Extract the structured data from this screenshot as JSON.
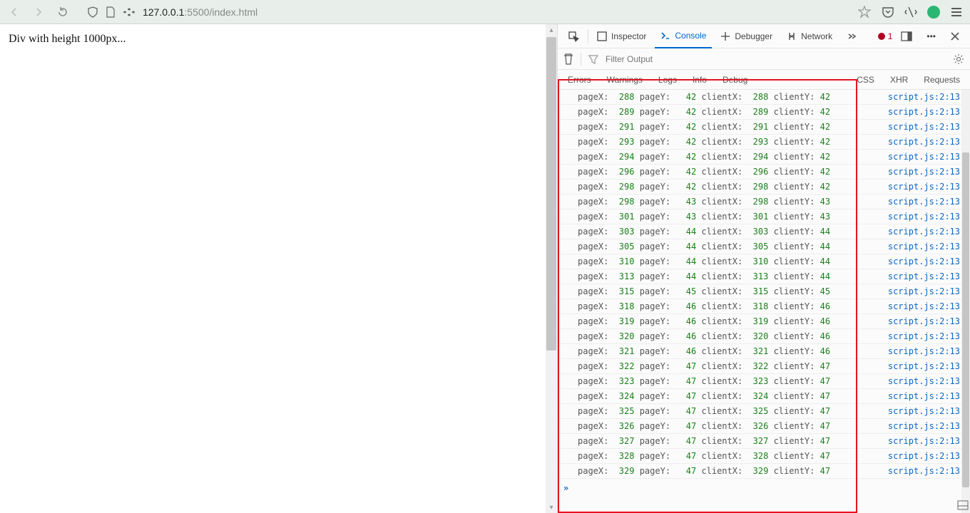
{
  "url": {
    "host": "127.0.0.1",
    "port": ":5500",
    "path": "/index.html"
  },
  "page": {
    "body_text": "Div with height 1000px..."
  },
  "devtools": {
    "tabs": {
      "inspector": "Inspector",
      "console": "Console",
      "debugger": "Debugger",
      "network": "Network"
    },
    "errors_badge": "1",
    "filter_placeholder": "Filter Output",
    "categories": [
      "Errors",
      "Warnings",
      "Logs",
      "Info",
      "Debug",
      "CSS",
      "XHR",
      "Requests"
    ],
    "source_ref": "script.js:2:13",
    "labels": {
      "pageX": "pageX:",
      "pageY": "pageY:",
      "clientX": "clientX:",
      "clientY": "clientY:"
    },
    "logs": [
      {
        "pageX": 288,
        "pageY": 42,
        "clientX": 288,
        "clientY": 42
      },
      {
        "pageX": 289,
        "pageY": 42,
        "clientX": 289,
        "clientY": 42
      },
      {
        "pageX": 291,
        "pageY": 42,
        "clientX": 291,
        "clientY": 42
      },
      {
        "pageX": 293,
        "pageY": 42,
        "clientX": 293,
        "clientY": 42
      },
      {
        "pageX": 294,
        "pageY": 42,
        "clientX": 294,
        "clientY": 42
      },
      {
        "pageX": 296,
        "pageY": 42,
        "clientX": 296,
        "clientY": 42
      },
      {
        "pageX": 298,
        "pageY": 42,
        "clientX": 298,
        "clientY": 42
      },
      {
        "pageX": 298,
        "pageY": 43,
        "clientX": 298,
        "clientY": 43
      },
      {
        "pageX": 301,
        "pageY": 43,
        "clientX": 301,
        "clientY": 43
      },
      {
        "pageX": 303,
        "pageY": 44,
        "clientX": 303,
        "clientY": 44
      },
      {
        "pageX": 305,
        "pageY": 44,
        "clientX": 305,
        "clientY": 44
      },
      {
        "pageX": 310,
        "pageY": 44,
        "clientX": 310,
        "clientY": 44
      },
      {
        "pageX": 313,
        "pageY": 44,
        "clientX": 313,
        "clientY": 44
      },
      {
        "pageX": 315,
        "pageY": 45,
        "clientX": 315,
        "clientY": 45
      },
      {
        "pageX": 318,
        "pageY": 46,
        "clientX": 318,
        "clientY": 46
      },
      {
        "pageX": 319,
        "pageY": 46,
        "clientX": 319,
        "clientY": 46
      },
      {
        "pageX": 320,
        "pageY": 46,
        "clientX": 320,
        "clientY": 46
      },
      {
        "pageX": 321,
        "pageY": 46,
        "clientX": 321,
        "clientY": 46
      },
      {
        "pageX": 322,
        "pageY": 47,
        "clientX": 322,
        "clientY": 47
      },
      {
        "pageX": 323,
        "pageY": 47,
        "clientX": 323,
        "clientY": 47
      },
      {
        "pageX": 324,
        "pageY": 47,
        "clientX": 324,
        "clientY": 47
      },
      {
        "pageX": 325,
        "pageY": 47,
        "clientX": 325,
        "clientY": 47
      },
      {
        "pageX": 326,
        "pageY": 47,
        "clientX": 326,
        "clientY": 47
      },
      {
        "pageX": 327,
        "pageY": 47,
        "clientX": 327,
        "clientY": 47
      },
      {
        "pageX": 328,
        "pageY": 47,
        "clientX": 328,
        "clientY": 47
      },
      {
        "pageX": 329,
        "pageY": 47,
        "clientX": 329,
        "clientY": 47
      }
    ]
  }
}
